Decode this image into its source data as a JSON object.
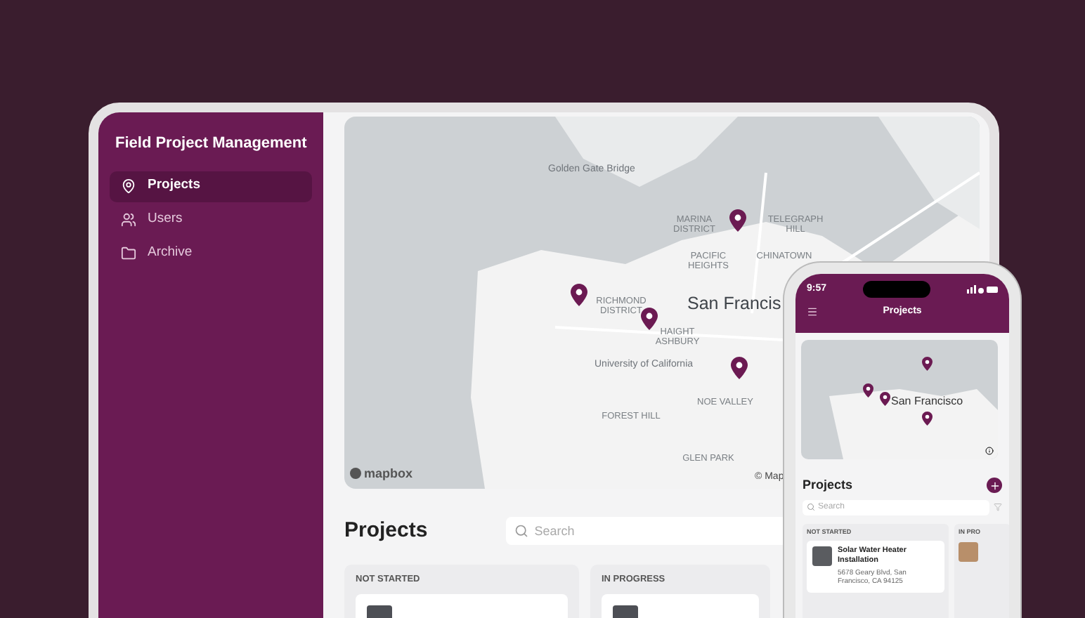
{
  "sidebar": {
    "title": "Field Project Management",
    "items": [
      {
        "label": "Projects",
        "selected": true
      },
      {
        "label": "Users",
        "selected": false
      },
      {
        "label": "Archive",
        "selected": false
      }
    ]
  },
  "map": {
    "labels": [
      {
        "text": "Golden Gate Bridge",
        "kind": "minor"
      },
      {
        "text": "MARINA DISTRICT",
        "kind": "district"
      },
      {
        "text": "TELEGRAPH HILL",
        "kind": "district"
      },
      {
        "text": "PACIFIC HEIGHTS",
        "kind": "district"
      },
      {
        "text": "CHINATOWN",
        "kind": "district"
      },
      {
        "text": "RICHMOND DISTRICT",
        "kind": "district"
      },
      {
        "text": "HAIGHT ASHBURY",
        "kind": "district"
      },
      {
        "text": "San Francis",
        "kind": "city"
      },
      {
        "text": "University of California",
        "kind": "minor"
      },
      {
        "text": "NOE VALLEY",
        "kind": "district"
      },
      {
        "text": "FOREST HILL",
        "kind": "district"
      },
      {
        "text": "GLEN PARK",
        "kind": "district"
      }
    ],
    "attribution": "mapbox",
    "copyright": "© Map"
  },
  "projects": {
    "title": "Projects",
    "search": {
      "placeholder": "Search"
    },
    "columns": [
      {
        "title": "NOT STARTED"
      },
      {
        "title": "IN PROGRESS"
      }
    ]
  },
  "phone": {
    "time": "9:57",
    "title": "Projects",
    "map_label": "San Francisco",
    "section_title": "Projects",
    "search": {
      "placeholder": "Search"
    },
    "columns": [
      {
        "title": "NOT STARTED",
        "cards": [
          {
            "title": "Solar Water Heater Installation",
            "address": "5678 Geary Blvd, San Francisco, CA 94125"
          }
        ]
      },
      {
        "title": "IN PRO"
      }
    ]
  }
}
